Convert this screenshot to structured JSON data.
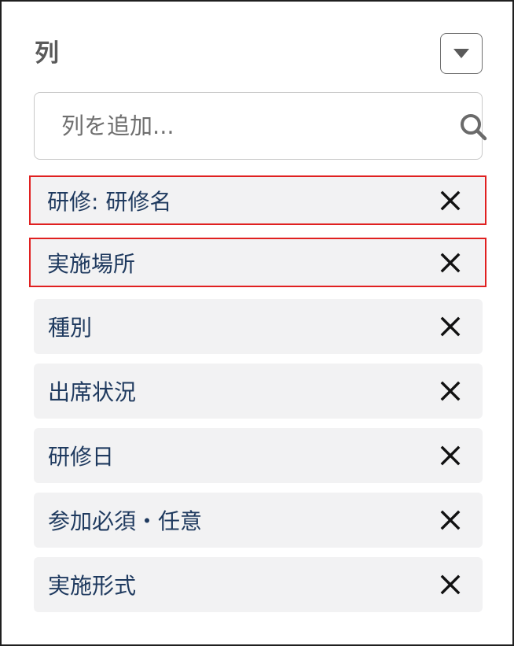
{
  "panel": {
    "title": "列",
    "menu_icon": "caret-down-icon"
  },
  "search": {
    "placeholder": "列を追加...",
    "value": "",
    "icon": "search-icon"
  },
  "columns": [
    {
      "label": "研修: 研修名",
      "highlighted": true
    },
    {
      "label": "実施場所",
      "highlighted": true
    },
    {
      "label": "種別",
      "highlighted": false
    },
    {
      "label": "出席状況",
      "highlighted": false
    },
    {
      "label": "研修日",
      "highlighted": false
    },
    {
      "label": "参加必須・任意",
      "highlighted": false
    },
    {
      "label": "実施形式",
      "highlighted": false
    }
  ],
  "remove_icon": "close-icon",
  "colors": {
    "label_text": "#1f3a5f",
    "item_background": "#f2f2f3",
    "highlight_border": "#e02020",
    "title_text": "#5a5a5a"
  }
}
